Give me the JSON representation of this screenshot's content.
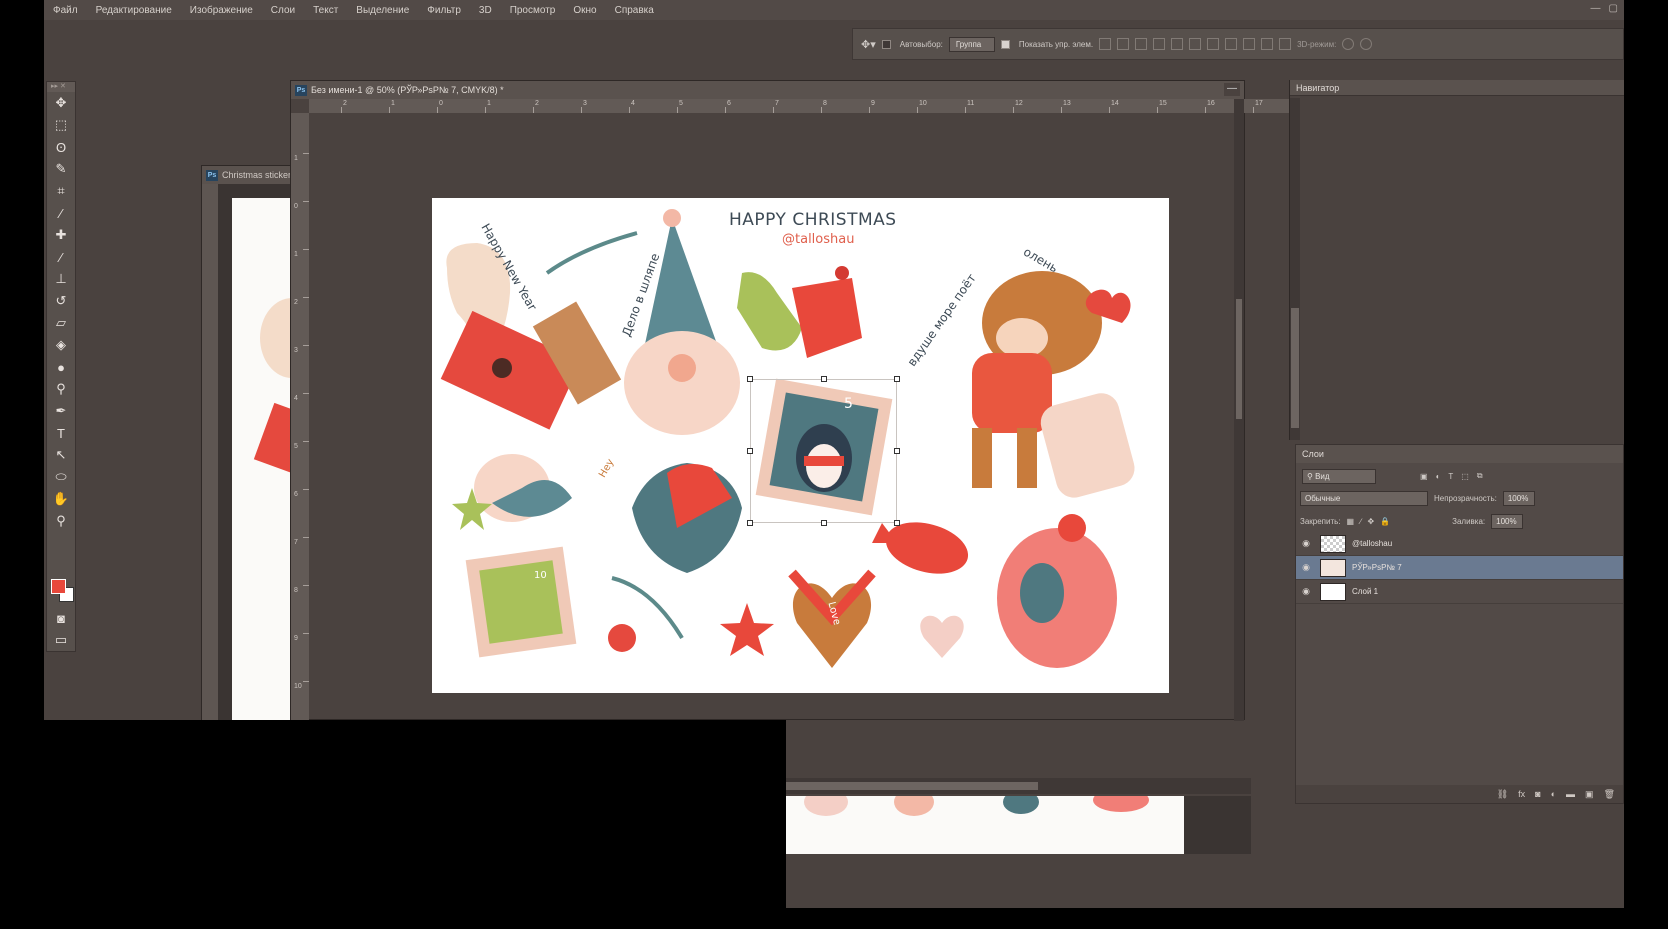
{
  "menu": [
    "Файл",
    "Редактирование",
    "Изображение",
    "Слои",
    "Текст",
    "Выделение",
    "Фильтр",
    "3D",
    "Просмотр",
    "Окно",
    "Справка"
  ],
  "options": {
    "autoselect_label": "Автовыбор:",
    "autoselect_value": "Группа",
    "show_controls_label": "Показать упр. элем.",
    "mode_3d_label": "3D-режим:"
  },
  "back_document": {
    "title": "Christmas sticker"
  },
  "main_document": {
    "title": "Без имени-1 @ 50% (РЎР»РѕР№ 7, CMYK/8) *",
    "ruler_h": [
      "2",
      "1",
      "0",
      "1",
      "2",
      "3",
      "4",
      "5",
      "6",
      "7",
      "8",
      "9",
      "10",
      "11",
      "12",
      "13",
      "14",
      "15",
      "16",
      "17"
    ],
    "ruler_v": [
      "1",
      "0",
      "1",
      "2",
      "3",
      "4",
      "5",
      "6",
      "7",
      "8",
      "9",
      "10"
    ]
  },
  "artwork": {
    "title": "HAPPY CHRISTMAS",
    "handle": "@talloshau",
    "bubble_text": "Happy New Year",
    "gnome_text": "Дело в шляпе",
    "deer_text1": "олень",
    "deer_text2": "вдуше море поёт",
    "stamp_value": "5",
    "mini_stamp_value": "10",
    "heart_text": "Love",
    "hat_text": "Hey"
  },
  "navigator": {
    "tab": "Навигатор"
  },
  "layers": {
    "tab": "Слои",
    "filter_label": "Вид",
    "blend_mode": "Обычные",
    "opacity_label": "Непрозрачность:",
    "opacity_value": "100%",
    "lock_label": "Закрепить:",
    "fill_label": "Заливка:",
    "fill_value": "100%",
    "items": [
      {
        "name": "@talloshau",
        "selected": false
      },
      {
        "name": "РЎР»РѕР№ 7",
        "selected": true
      },
      {
        "name": "Слой 1",
        "selected": false
      }
    ]
  },
  "colors": {
    "foreground": "#e8483b",
    "background": "#ffffff",
    "selected_layer": "#6a7a91"
  }
}
